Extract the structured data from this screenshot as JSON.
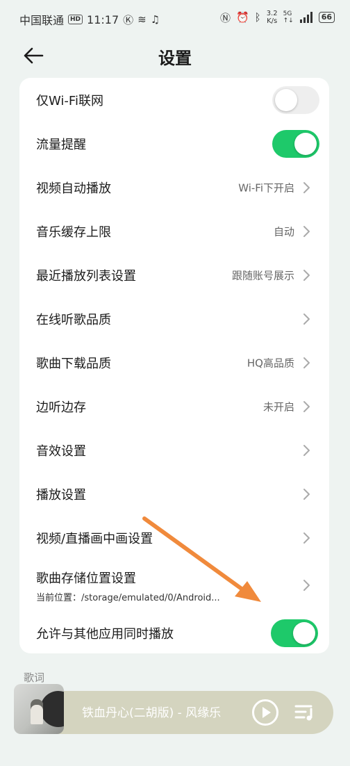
{
  "status_bar": {
    "carrier": "中国联通",
    "hd": "HD",
    "time": "11:17",
    "speed_value": "3.2",
    "speed_unit": "K/s",
    "net_top": "5G",
    "net_bottom": "↑↓",
    "battery": "66"
  },
  "header": {
    "title": "设置"
  },
  "settings": {
    "wifi_only": {
      "label": "仅Wi-Fi联网",
      "enabled": false
    },
    "data_alert": {
      "label": "流量提醒",
      "enabled": true
    },
    "video_autoplay": {
      "label": "视频自动播放",
      "value": "Wi-Fi下开启"
    },
    "music_cache": {
      "label": "音乐缓存上限",
      "value": "自动"
    },
    "recent_playlist": {
      "label": "最近播放列表设置",
      "value": "跟随账号展示"
    },
    "online_quality": {
      "label": "在线听歌品质",
      "value": ""
    },
    "download_quality": {
      "label": "歌曲下载品质",
      "value": "HQ高品质"
    },
    "listen_cache": {
      "label": "边听边存",
      "value": "未开启"
    },
    "sound_effects": {
      "label": "音效设置"
    },
    "playback": {
      "label": "播放设置"
    },
    "pip": {
      "label": "视频/直播画中画设置"
    },
    "storage": {
      "label": "歌曲存储位置设置",
      "sub": "当前位置：/storage/emulated/0/Android..."
    },
    "mix_playback": {
      "label": "允许与其他应用同时播放",
      "enabled": true
    }
  },
  "section": {
    "lyrics": "歌词"
  },
  "player": {
    "song": "铁血丹心(二胡版) - 风缘乐"
  },
  "colors": {
    "toggle_on": "#1ec96a",
    "toggle_off": "#eeeeee",
    "annotation_arrow": "#f08a3c",
    "player_bg": "#d4d4bf"
  }
}
